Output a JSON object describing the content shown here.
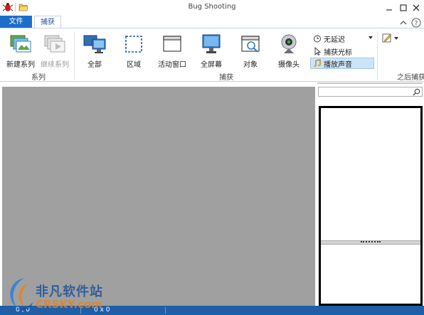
{
  "window": {
    "title": "Bug Shooting",
    "controls": [
      "minimize",
      "maximize",
      "close"
    ]
  },
  "tabs": [
    {
      "label": "文件",
      "selected": false
    },
    {
      "label": "捕获",
      "selected": true
    }
  ],
  "ribbon": {
    "series_group": {
      "label": "系列",
      "buttons": [
        {
          "label": "新建系列",
          "icon": "new-series-icon",
          "enabled": true
        },
        {
          "label": "继续系列",
          "icon": "continue-series-icon",
          "enabled": false
        }
      ]
    },
    "capture_group": {
      "label": "捕获",
      "buttons": [
        {
          "label": "全部",
          "icon": "all-screens-icon"
        },
        {
          "label": "区域",
          "icon": "region-icon"
        },
        {
          "label": "活动窗口",
          "icon": "active-window-icon"
        },
        {
          "label": "全屏幕",
          "icon": "fullscreen-icon"
        },
        {
          "label": "对象",
          "icon": "object-icon"
        },
        {
          "label": "摄像头",
          "icon": "webcam-icon"
        }
      ],
      "options": [
        {
          "label": "无延迟",
          "icon": "timer-icon",
          "active": false
        },
        {
          "label": "捕获光标",
          "icon": "cursor-icon",
          "active": false
        },
        {
          "label": "播放声音",
          "icon": "music-note-icon",
          "active": true
        }
      ]
    },
    "after_group": {
      "label": "之后捕获"
    }
  },
  "sidebar": {
    "search_placeholder": "",
    "search_value": ""
  },
  "status": {
    "left": "0 , 0",
    "size": "0 x 0"
  },
  "watermark": {
    "cn": "非凡软件站",
    "en": "CRSKY.com"
  },
  "colors": {
    "accent": "#1e6ec8",
    "canvas": "#a0a0a0",
    "statusbar": "#1e5fa8",
    "active_option": "#cde4f7"
  }
}
